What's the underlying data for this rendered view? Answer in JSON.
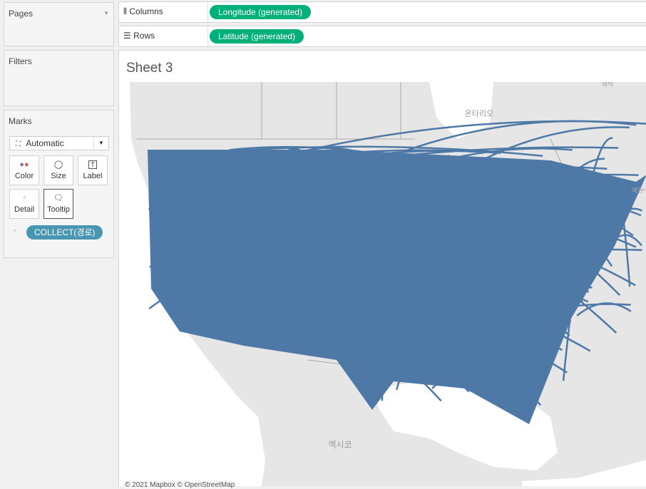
{
  "left": {
    "pages": "Pages",
    "filters": "Filters",
    "marks": "Marks",
    "mark_type": "Automatic",
    "buttons": [
      "Color",
      "Size",
      "Label",
      "Detail",
      "Tooltip"
    ],
    "pill": "COLLECT(경로)"
  },
  "shelves": {
    "columns_label": "Columns",
    "columns_pill": "Longitude (generated)",
    "rows_label": "Rows",
    "rows_pill": "Latitude (generated)"
  },
  "sheet": {
    "title": "Sheet 3",
    "map_labels": {
      "ontario": "온타리오",
      "mexico": "멕시코",
      "quebec": "퀘벡",
      "maine": "메인"
    },
    "attribution": "© 2021 Mapbox © OpenStreetMap"
  },
  "colors": {
    "route": "#4e79a7",
    "pill_green": "#00b07a",
    "pill_blue": "#4996b2"
  }
}
